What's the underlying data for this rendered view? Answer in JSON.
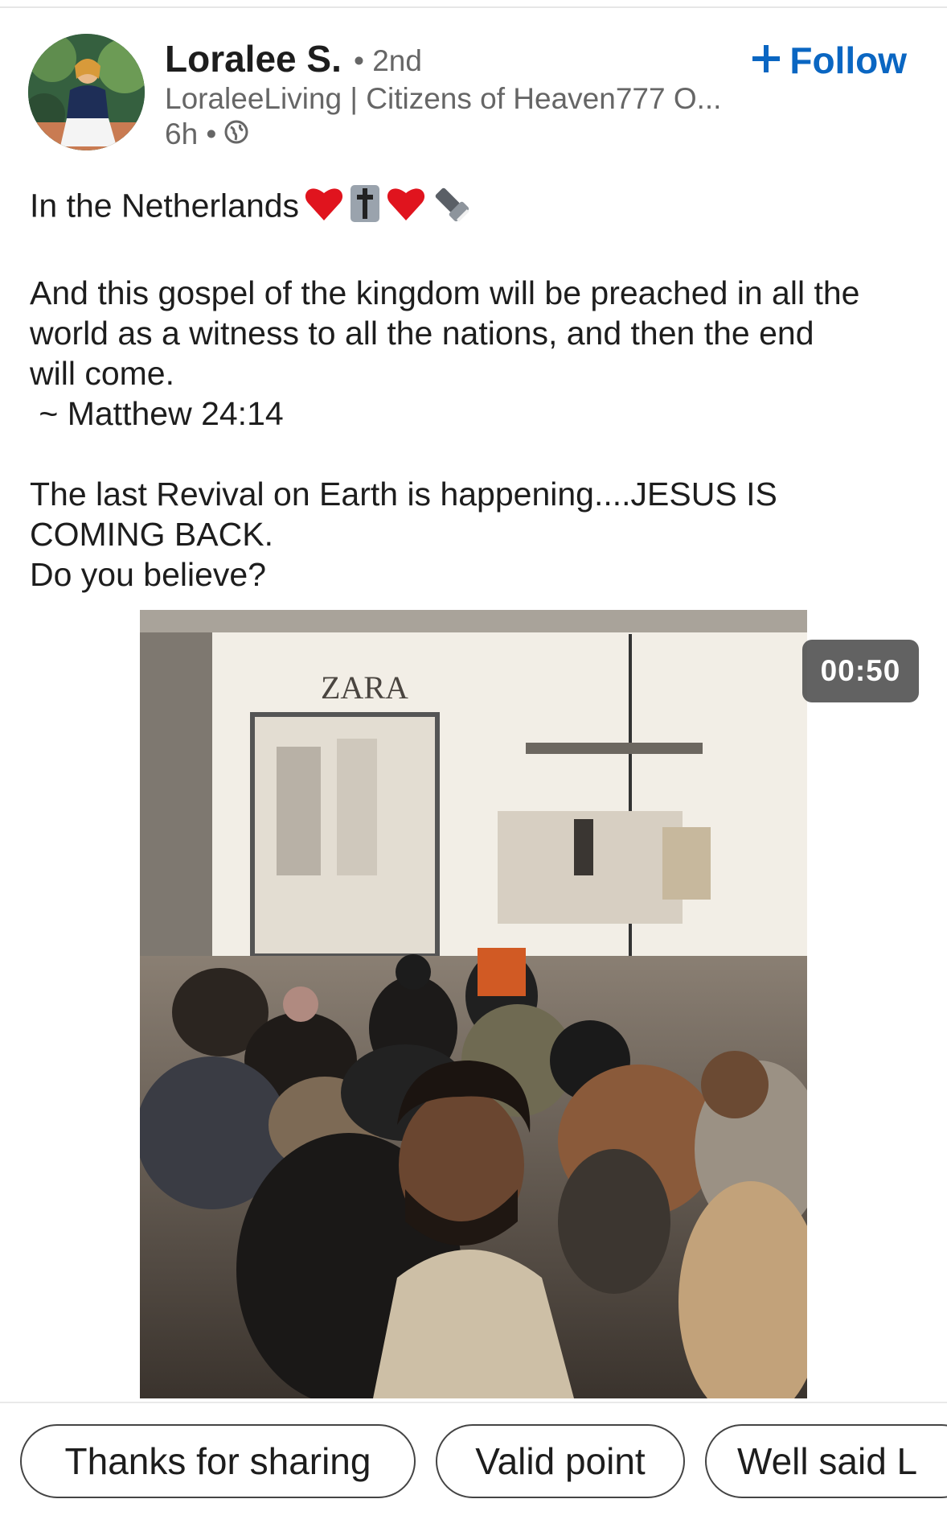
{
  "author": {
    "name": "Loralee S.",
    "degree": "• 2nd",
    "headline": "LoraleeLiving | Citizens of Heaven777 O...",
    "time": "6h •",
    "visibility_icon": "globe-icon"
  },
  "follow": {
    "label": "Follow",
    "icon": "plus-icon",
    "color": "#0a66c2"
  },
  "post": {
    "line1": "In the Netherlands",
    "line1_emojis": [
      "red-heart",
      "latin-cross",
      "red-heart",
      "flashlight"
    ],
    "verse_lines": [
      "And this gospel of the kingdom will be preached in all the",
      "world as a witness to all the nations, and then the end",
      "will come."
    ],
    "reference": " ~ Matthew 24:14",
    "closing_lines": [
      "The last Revival on Earth is happening....JESUS IS",
      "COMING BACK.",
      "Do you believe?"
    ]
  },
  "video": {
    "duration": "00:50",
    "store_sign": "ZARA"
  },
  "quick_replies": [
    "Thanks for sharing",
    "Valid point",
    "Well said L"
  ]
}
